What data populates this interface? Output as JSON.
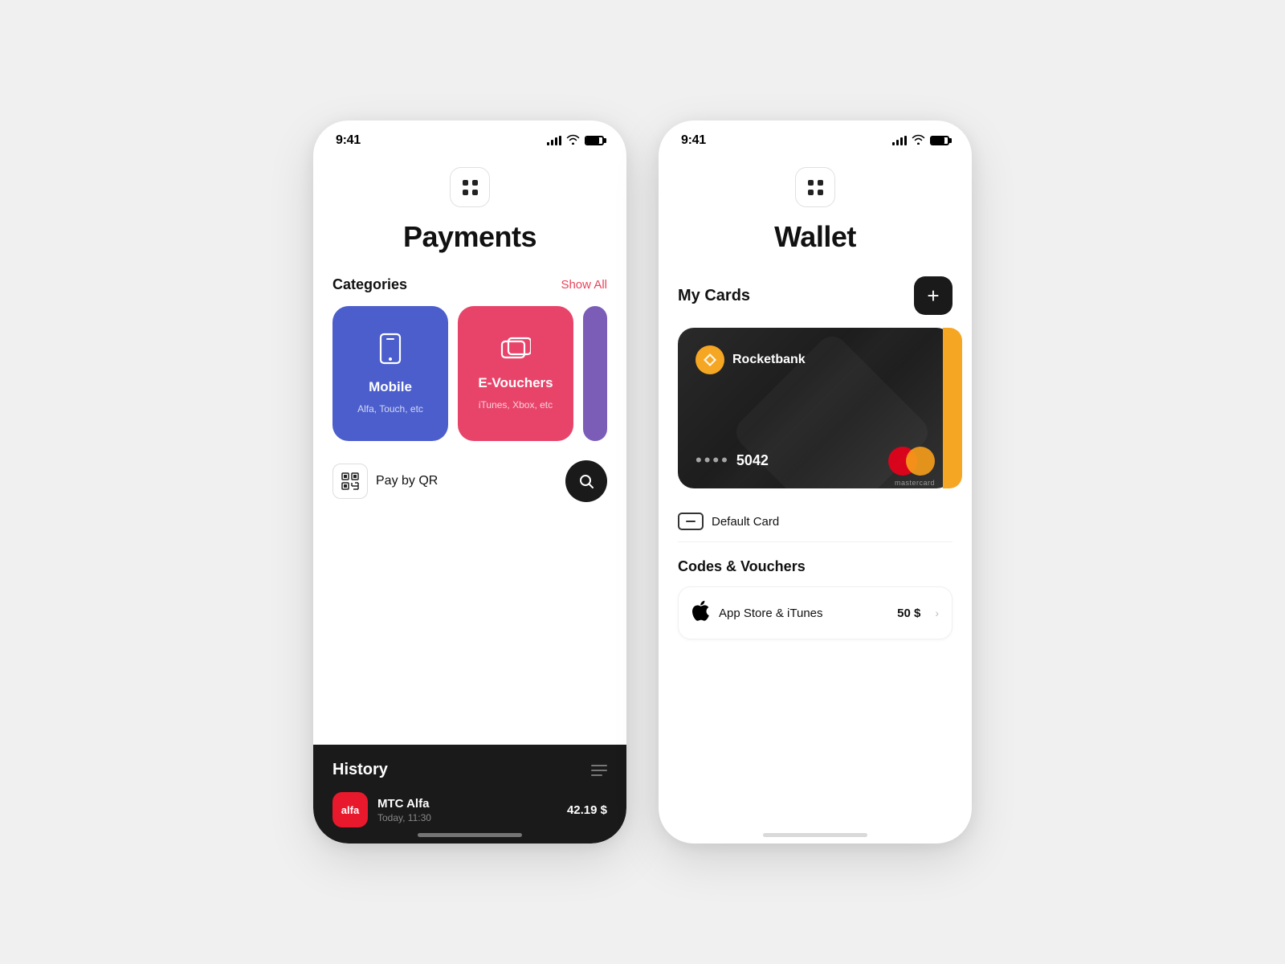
{
  "payments": {
    "status_time": "9:41",
    "page_title": "Payments",
    "categories_label": "Categories",
    "show_all_label": "Show All",
    "categories": [
      {
        "id": "mobile",
        "name": "Mobile",
        "sub": "Alfa, Touch, etc",
        "icon": "📱",
        "color": "#4b5ecc"
      },
      {
        "id": "evouchers",
        "name": "E-Vouchers",
        "sub": "iTunes, Xbox, etc",
        "icon": "🎁",
        "color": "#e8446a"
      }
    ],
    "pay_by_qr_label": "Pay by QR",
    "history_title": "History",
    "history_items": [
      {
        "merchant": "MTC Alfa",
        "logo_text": "alfa",
        "date": "Today, 11:30",
        "amount": "42.19 $"
      }
    ]
  },
  "wallet": {
    "status_time": "9:41",
    "page_title": "Wallet",
    "my_cards_title": "My Cards",
    "add_button_label": "+",
    "card": {
      "bank_name": "Rocketbank",
      "dots": "••••",
      "last4": "5042",
      "mastercard_label": "mastercard"
    },
    "default_card_label": "Default Card",
    "codes_title": "Codes & Vouchers",
    "vouchers": [
      {
        "name": "App Store & iTunes",
        "amount": "50 $"
      }
    ]
  }
}
